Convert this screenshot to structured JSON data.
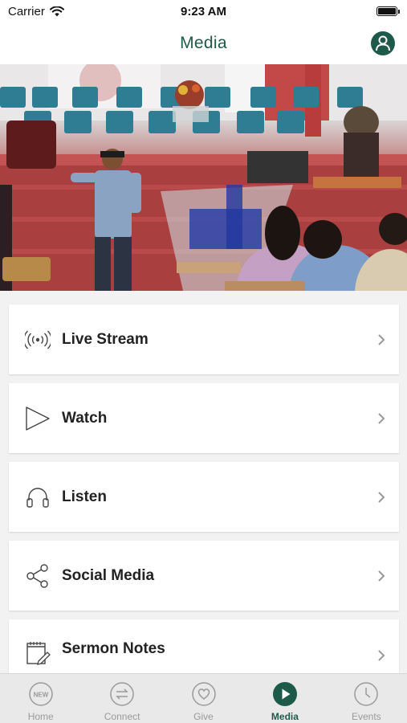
{
  "status_bar": {
    "carrier": "Carrier",
    "time": "9:23 AM"
  },
  "nav": {
    "title": "Media",
    "profile_icon": "person-icon"
  },
  "hero": {
    "alt": "church-service-photo"
  },
  "menu": {
    "items": [
      {
        "label": "Live Stream",
        "icon": "broadcast-icon"
      },
      {
        "label": "Watch",
        "icon": "play-outline-icon"
      },
      {
        "label": "Listen",
        "icon": "headphones-icon"
      },
      {
        "label": "Social Media",
        "icon": "share-icon"
      },
      {
        "label": "Sermon Notes",
        "icon": "notepad-icon"
      }
    ]
  },
  "tabs": [
    {
      "label": "Home",
      "icon": "new-badge-icon",
      "active": false
    },
    {
      "label": "Connect",
      "icon": "arrows-exchange-icon",
      "active": false
    },
    {
      "label": "Give",
      "icon": "heart-icon",
      "active": false
    },
    {
      "label": "Media",
      "icon": "play-filled-icon",
      "active": true
    },
    {
      "label": "Events",
      "icon": "clock-icon",
      "active": false
    }
  ],
  "colors": {
    "brand": "#1e5a4a",
    "tab_inactive": "#9a9a9a",
    "background": "#f2f2f2"
  }
}
